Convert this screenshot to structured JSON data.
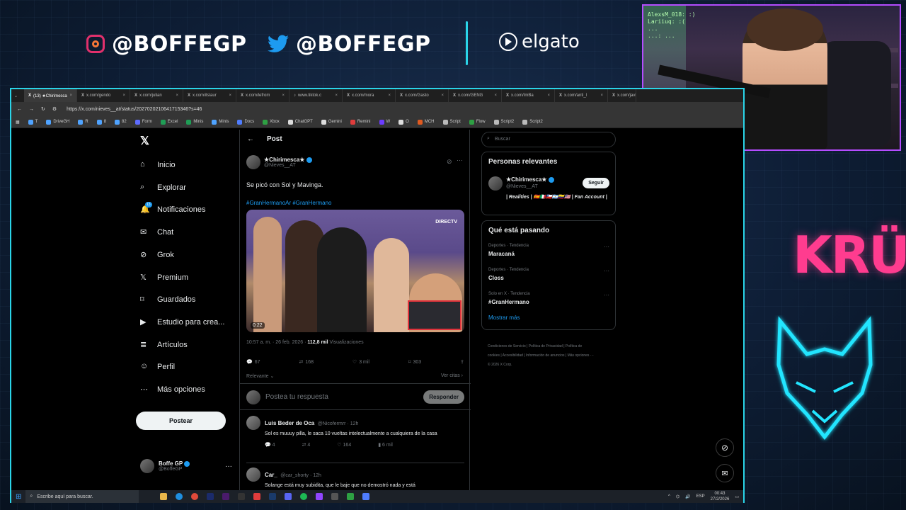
{
  "overlay": {
    "instagram_handle": "@BOFFEGP",
    "twitter_handle": "@BOFFEGP",
    "sponsor": "elgato",
    "team_logo": "KRÜ",
    "cam_chat_lines": [
      "AlexsM_018: :)",
      "Lariiuq: :(",
      "...",
      "...: ..."
    ]
  },
  "browser": {
    "tabs": [
      {
        "label": "(13) ★Chirimesca",
        "active": true
      },
      {
        "label": "x.com/gendo",
        "active": false
      },
      {
        "label": "x.com/julian",
        "active": false
      },
      {
        "label": "x.com/itslaur",
        "active": false
      },
      {
        "label": "x.com/lefrom",
        "active": false
      },
      {
        "label": "www.tiktok.c",
        "active": false
      },
      {
        "label": "x.com/mora",
        "active": false
      },
      {
        "label": "x.com/Gasto",
        "active": false
      },
      {
        "label": "x.com/GENG",
        "active": false
      },
      {
        "label": "x.com/ImBa",
        "active": false
      },
      {
        "label": "x.com/anti_l",
        "active": false
      },
      {
        "label": "x.com/javi",
        "active": false
      }
    ],
    "url": "https://x.com/nieves__at/status/2027020210641715346?s=46",
    "bookmarks": [
      {
        "label": "T",
        "color": "#4fa3ff"
      },
      {
        "label": "DriveGH",
        "color": "#4fa3ff"
      },
      {
        "label": "R",
        "color": "#4fa3ff"
      },
      {
        "label": "8",
        "color": "#4fa3ff"
      },
      {
        "label": "82",
        "color": "#4fa3ff"
      },
      {
        "label": "Form",
        "color": "#5e6cff"
      },
      {
        "label": "Excel",
        "color": "#1f9d55"
      },
      {
        "label": "Minis",
        "color": "#1f9d55"
      },
      {
        "label": "Minis",
        "color": "#4fa3ff"
      },
      {
        "label": "Docs",
        "color": "#4f7dff"
      },
      {
        "label": "Xbox",
        "color": "#2ea043"
      },
      {
        "label": "ChatGPT",
        "color": "#dddddd"
      },
      {
        "label": "Gemini",
        "color": "#dddddd"
      },
      {
        "label": "Remini",
        "color": "#e03c3c"
      },
      {
        "label": "W",
        "color": "#6c3cff"
      },
      {
        "label": "O",
        "color": "#dddddd"
      },
      {
        "label": "MCH",
        "color": "#e05a20"
      },
      {
        "label": "Script",
        "color": "#bbbbbb"
      },
      {
        "label": "Flow",
        "color": "#2ea043"
      },
      {
        "label": "Script2",
        "color": "#bbbbbb"
      },
      {
        "label": "Script2",
        "color": "#bbbbbb"
      }
    ]
  },
  "x": {
    "nav": [
      {
        "label": "Inicio",
        "icon": "home-icon"
      },
      {
        "label": "Explorar",
        "icon": "search-icon"
      },
      {
        "label": "Notificaciones",
        "icon": "bell-icon",
        "badge": "13"
      },
      {
        "label": "Chat",
        "icon": "mail-icon"
      },
      {
        "label": "Grok",
        "icon": "grok-icon"
      },
      {
        "label": "Premium",
        "icon": "x-logo-icon"
      },
      {
        "label": "Guardados",
        "icon": "bookmark-icon"
      },
      {
        "label": "Estudio para crea...",
        "icon": "studio-icon"
      },
      {
        "label": "Artículos",
        "icon": "article-icon"
      },
      {
        "label": "Perfil",
        "icon": "user-icon"
      },
      {
        "label": "Más opciones",
        "icon": "more-icon"
      }
    ],
    "post_button": "Postear",
    "me": {
      "name": "Boffe GP",
      "handle": "@BoffeGP"
    },
    "header_title": "Post",
    "tweet": {
      "author_name": "★Chirimesca★",
      "author_handle": "@Nieves__AT",
      "text": "Se picó con Sol y Mavinga.",
      "hashtags": "#GranHermanoAr #GranHermano",
      "video_duration": "0:22",
      "channel_logo": "DIRECTV",
      "time": "10:57 a. m. · 26 feb. 2026 · ",
      "views_count": "112,8 mil",
      "views_label": " Visualizaciones",
      "replies": "67",
      "reposts": "168",
      "likes": "3 mil",
      "bookmarks": "303",
      "sort_label": "Relevante",
      "quotes_label": "Ver citas"
    },
    "reply_placeholder": "Postea tu respuesta",
    "reply_button": "Responder",
    "replies": [
      {
        "name": "Luis Beder de Oca",
        "handle": "@Nicofermrr · 12h",
        "text": "Sol es muuuy pilla, le saca 10 vueltas intelectualmente a cualquiera de la casa",
        "replies": "4",
        "reposts": "4",
        "likes": "164",
        "views": "6 mil"
      },
      {
        "name": "Car_",
        "handle": "@car_shorty · 12h",
        "text": "Solange está muy subidita, que le baje que no demostró nada y está",
        "replies": "",
        "reposts": "",
        "likes": "",
        "views": ""
      }
    ],
    "search_placeholder": "Buscar",
    "relevant": {
      "title": "Personas relevantes",
      "name": "★Chirimesca★",
      "handle": "@Nieves__AT",
      "bio": "| Realities | 🇪🇸🇮🇹🇨🇱🇦🇷🇨🇴🇺🇸 | Fan Account |",
      "follow": "Seguir"
    },
    "trends": {
      "title": "Qué está pasando",
      "items": [
        {
          "context": "Deportes · Tendencia",
          "topic": "Maracaná"
        },
        {
          "context": "Deportes · Tendencia",
          "topic": "Closs"
        },
        {
          "context": "Solo en X · Tendencia",
          "topic": "#GranHermano"
        }
      ],
      "show_more": "Mostrar más"
    },
    "footer": "Condiciones de Servicio  |  Política de Privacidad  |  Política de cookies  |  Accesibilidad  |  Información de anuncios  |  Más opciones ···  © 2026 X Corp."
  },
  "taskbar": {
    "search": "Escribe aquí para buscar.",
    "lang": "ESP",
    "time": "00:43",
    "date": "27/2/2026"
  },
  "colors": {
    "accent": "#1d9bf0",
    "frame": "#2ad4e8",
    "cam_border": "#b44cff",
    "kru": "#ff3c8f"
  }
}
